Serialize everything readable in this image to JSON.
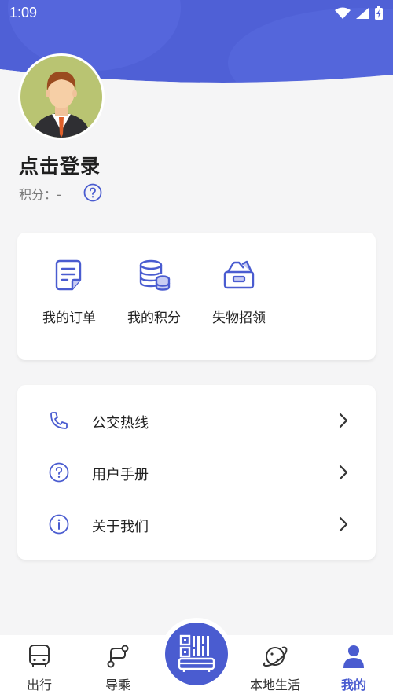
{
  "status_bar": {
    "time": "1:09",
    "icons": [
      "wifi-icon",
      "signal-icon",
      "battery-charging-icon"
    ]
  },
  "theme": {
    "accent": "#4a5cd0",
    "header_bg": "#4f60d6",
    "text": "#222222",
    "muted": "#7a7a7a"
  },
  "profile": {
    "login_prompt": "点击登录",
    "points_label": "积分：-",
    "avatar": "avatar-man-icon",
    "help": "question-circle-icon"
  },
  "quick_actions": [
    {
      "label": "我的订单",
      "icon": "order-document-icon"
    },
    {
      "label": "我的积分",
      "icon": "points-coins-icon"
    },
    {
      "label": "失物招领",
      "icon": "lost-found-box-icon"
    }
  ],
  "menu": [
    {
      "label": "公交热线",
      "icon": "phone-icon"
    },
    {
      "label": "用户手册",
      "icon": "question-circle-icon"
    },
    {
      "label": "关于我们",
      "icon": "info-circle-icon"
    }
  ],
  "tabbar": {
    "tabs": [
      {
        "label": "出行",
        "icon": "bus-icon",
        "active": false
      },
      {
        "label": "导乘",
        "icon": "route-icon",
        "active": false
      },
      {
        "label": "本地生活",
        "icon": "planet-icon",
        "active": false
      },
      {
        "label": "我的",
        "icon": "person-icon",
        "active": true
      }
    ],
    "center": {
      "icon": "qr-bus-code-icon"
    }
  }
}
